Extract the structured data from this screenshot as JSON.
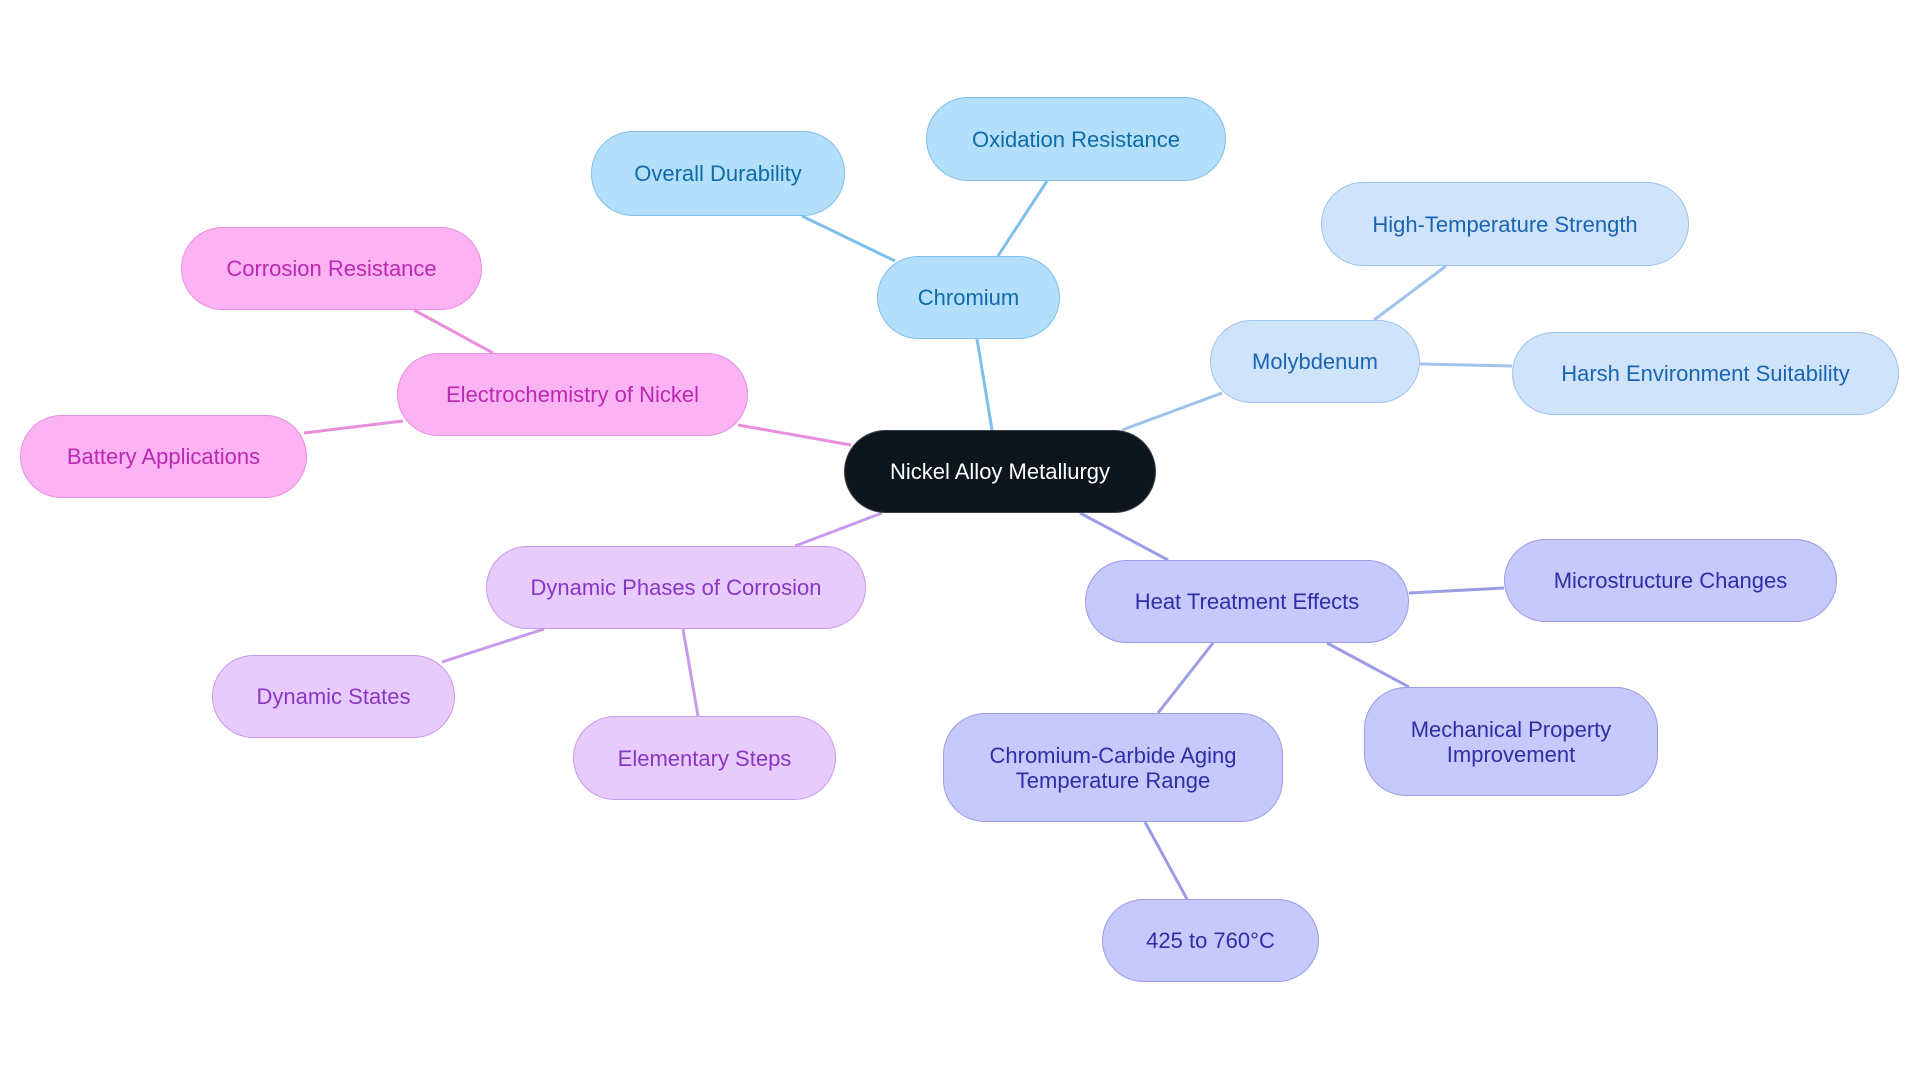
{
  "diagram": {
    "type": "mindmap",
    "root": {
      "id": "root",
      "label": "Nickel Alloy Metallurgy"
    },
    "branches": [
      {
        "id": "chromium",
        "label": "Chromium",
        "color_group": "chromium",
        "fill": "#b3dffb",
        "stroke": "#7ec0ea",
        "text_color": "#0e6ba8",
        "edge_color": "#7ec0ea",
        "children": [
          {
            "id": "oxidation-resistance",
            "label": "Oxidation Resistance"
          },
          {
            "id": "overall-durability",
            "label": "Overall Durability"
          }
        ]
      },
      {
        "id": "molybdenum",
        "label": "Molybdenum",
        "color_group": "moly",
        "fill": "#cfe4fb",
        "stroke": "#9fc3ec",
        "text_color": "#1a64b4",
        "edge_color": "#9fc3ec",
        "children": [
          {
            "id": "high-temperature-strength",
            "label": "High-Temperature Strength"
          },
          {
            "id": "harsh-environment-suitability",
            "label": "Harsh Environment Suitability"
          }
        ]
      },
      {
        "id": "electrochemistry",
        "label": "Electrochemistry of Nickel",
        "color_group": "electro",
        "fill": "#fbb3f3",
        "stroke": "#e88fde",
        "text_color": "#bc28b4",
        "edge_color": "#e88fde",
        "children": [
          {
            "id": "corrosion-resistance",
            "label": "Corrosion Resistance"
          },
          {
            "id": "battery-applications",
            "label": "Battery Applications"
          }
        ]
      },
      {
        "id": "dynamic-phases",
        "label": "Dynamic Phases of Corrosion",
        "color_group": "dynamic",
        "fill": "#e7cbfc",
        "stroke": "#c89aeb",
        "text_color": "#8a36c4",
        "edge_color": "#c89aeb",
        "children": [
          {
            "id": "dynamic-states",
            "label": "Dynamic States"
          },
          {
            "id": "elementary-steps",
            "label": "Elementary Steps"
          }
        ]
      },
      {
        "id": "heat-treatment",
        "label": "Heat Treatment Effects",
        "color_group": "heat",
        "fill": "#c6c9fc",
        "stroke": "#9a9de6",
        "text_color": "#2f2ea6",
        "edge_color": "#9a9de6",
        "children": [
          {
            "id": "microstructure-changes",
            "label": "Microstructure Changes"
          },
          {
            "id": "mechanical-property-improvement",
            "label": "Mechanical Property\nImprovement"
          },
          {
            "id": "chromium-carbide-aging",
            "label": "Chromium-Carbide Aging\nTemperature Range",
            "children": [
              {
                "id": "temp-range-value",
                "label": "425 to 760°C"
              }
            ]
          }
        ]
      }
    ],
    "root_colors": {
      "fill": "#0d151d",
      "stroke": "#3a3f46",
      "text_color": "#ffffff"
    }
  }
}
